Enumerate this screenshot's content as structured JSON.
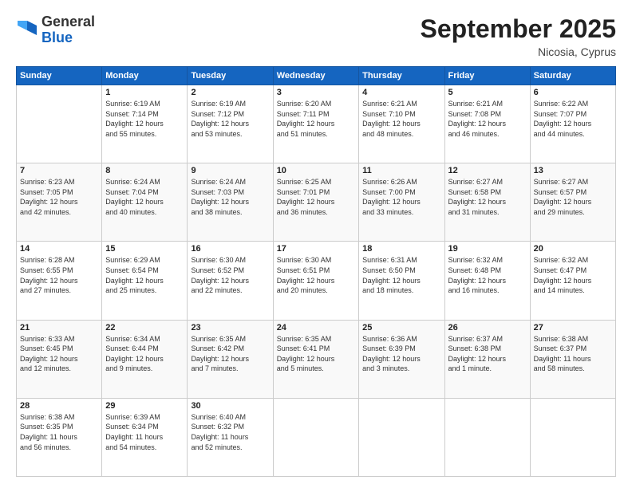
{
  "header": {
    "logo_general": "General",
    "logo_blue": "Blue",
    "title": "September 2025",
    "subtitle": "Nicosia, Cyprus"
  },
  "weekdays": [
    "Sunday",
    "Monday",
    "Tuesday",
    "Wednesday",
    "Thursday",
    "Friday",
    "Saturday"
  ],
  "weeks": [
    [
      {
        "day": "",
        "info": ""
      },
      {
        "day": "1",
        "info": "Sunrise: 6:19 AM\nSunset: 7:14 PM\nDaylight: 12 hours\nand 55 minutes."
      },
      {
        "day": "2",
        "info": "Sunrise: 6:19 AM\nSunset: 7:12 PM\nDaylight: 12 hours\nand 53 minutes."
      },
      {
        "day": "3",
        "info": "Sunrise: 6:20 AM\nSunset: 7:11 PM\nDaylight: 12 hours\nand 51 minutes."
      },
      {
        "day": "4",
        "info": "Sunrise: 6:21 AM\nSunset: 7:10 PM\nDaylight: 12 hours\nand 48 minutes."
      },
      {
        "day": "5",
        "info": "Sunrise: 6:21 AM\nSunset: 7:08 PM\nDaylight: 12 hours\nand 46 minutes."
      },
      {
        "day": "6",
        "info": "Sunrise: 6:22 AM\nSunset: 7:07 PM\nDaylight: 12 hours\nand 44 minutes."
      }
    ],
    [
      {
        "day": "7",
        "info": "Sunrise: 6:23 AM\nSunset: 7:05 PM\nDaylight: 12 hours\nand 42 minutes."
      },
      {
        "day": "8",
        "info": "Sunrise: 6:24 AM\nSunset: 7:04 PM\nDaylight: 12 hours\nand 40 minutes."
      },
      {
        "day": "9",
        "info": "Sunrise: 6:24 AM\nSunset: 7:03 PM\nDaylight: 12 hours\nand 38 minutes."
      },
      {
        "day": "10",
        "info": "Sunrise: 6:25 AM\nSunset: 7:01 PM\nDaylight: 12 hours\nand 36 minutes."
      },
      {
        "day": "11",
        "info": "Sunrise: 6:26 AM\nSunset: 7:00 PM\nDaylight: 12 hours\nand 33 minutes."
      },
      {
        "day": "12",
        "info": "Sunrise: 6:27 AM\nSunset: 6:58 PM\nDaylight: 12 hours\nand 31 minutes."
      },
      {
        "day": "13",
        "info": "Sunrise: 6:27 AM\nSunset: 6:57 PM\nDaylight: 12 hours\nand 29 minutes."
      }
    ],
    [
      {
        "day": "14",
        "info": "Sunrise: 6:28 AM\nSunset: 6:55 PM\nDaylight: 12 hours\nand 27 minutes."
      },
      {
        "day": "15",
        "info": "Sunrise: 6:29 AM\nSunset: 6:54 PM\nDaylight: 12 hours\nand 25 minutes."
      },
      {
        "day": "16",
        "info": "Sunrise: 6:30 AM\nSunset: 6:52 PM\nDaylight: 12 hours\nand 22 minutes."
      },
      {
        "day": "17",
        "info": "Sunrise: 6:30 AM\nSunset: 6:51 PM\nDaylight: 12 hours\nand 20 minutes."
      },
      {
        "day": "18",
        "info": "Sunrise: 6:31 AM\nSunset: 6:50 PM\nDaylight: 12 hours\nand 18 minutes."
      },
      {
        "day": "19",
        "info": "Sunrise: 6:32 AM\nSunset: 6:48 PM\nDaylight: 12 hours\nand 16 minutes."
      },
      {
        "day": "20",
        "info": "Sunrise: 6:32 AM\nSunset: 6:47 PM\nDaylight: 12 hours\nand 14 minutes."
      }
    ],
    [
      {
        "day": "21",
        "info": "Sunrise: 6:33 AM\nSunset: 6:45 PM\nDaylight: 12 hours\nand 12 minutes."
      },
      {
        "day": "22",
        "info": "Sunrise: 6:34 AM\nSunset: 6:44 PM\nDaylight: 12 hours\nand 9 minutes."
      },
      {
        "day": "23",
        "info": "Sunrise: 6:35 AM\nSunset: 6:42 PM\nDaylight: 12 hours\nand 7 minutes."
      },
      {
        "day": "24",
        "info": "Sunrise: 6:35 AM\nSunset: 6:41 PM\nDaylight: 12 hours\nand 5 minutes."
      },
      {
        "day": "25",
        "info": "Sunrise: 6:36 AM\nSunset: 6:39 PM\nDaylight: 12 hours\nand 3 minutes."
      },
      {
        "day": "26",
        "info": "Sunrise: 6:37 AM\nSunset: 6:38 PM\nDaylight: 12 hours\nand 1 minute."
      },
      {
        "day": "27",
        "info": "Sunrise: 6:38 AM\nSunset: 6:37 PM\nDaylight: 11 hours\nand 58 minutes."
      }
    ],
    [
      {
        "day": "28",
        "info": "Sunrise: 6:38 AM\nSunset: 6:35 PM\nDaylight: 11 hours\nand 56 minutes."
      },
      {
        "day": "29",
        "info": "Sunrise: 6:39 AM\nSunset: 6:34 PM\nDaylight: 11 hours\nand 54 minutes."
      },
      {
        "day": "30",
        "info": "Sunrise: 6:40 AM\nSunset: 6:32 PM\nDaylight: 11 hours\nand 52 minutes."
      },
      {
        "day": "",
        "info": ""
      },
      {
        "day": "",
        "info": ""
      },
      {
        "day": "",
        "info": ""
      },
      {
        "day": "",
        "info": ""
      }
    ]
  ]
}
